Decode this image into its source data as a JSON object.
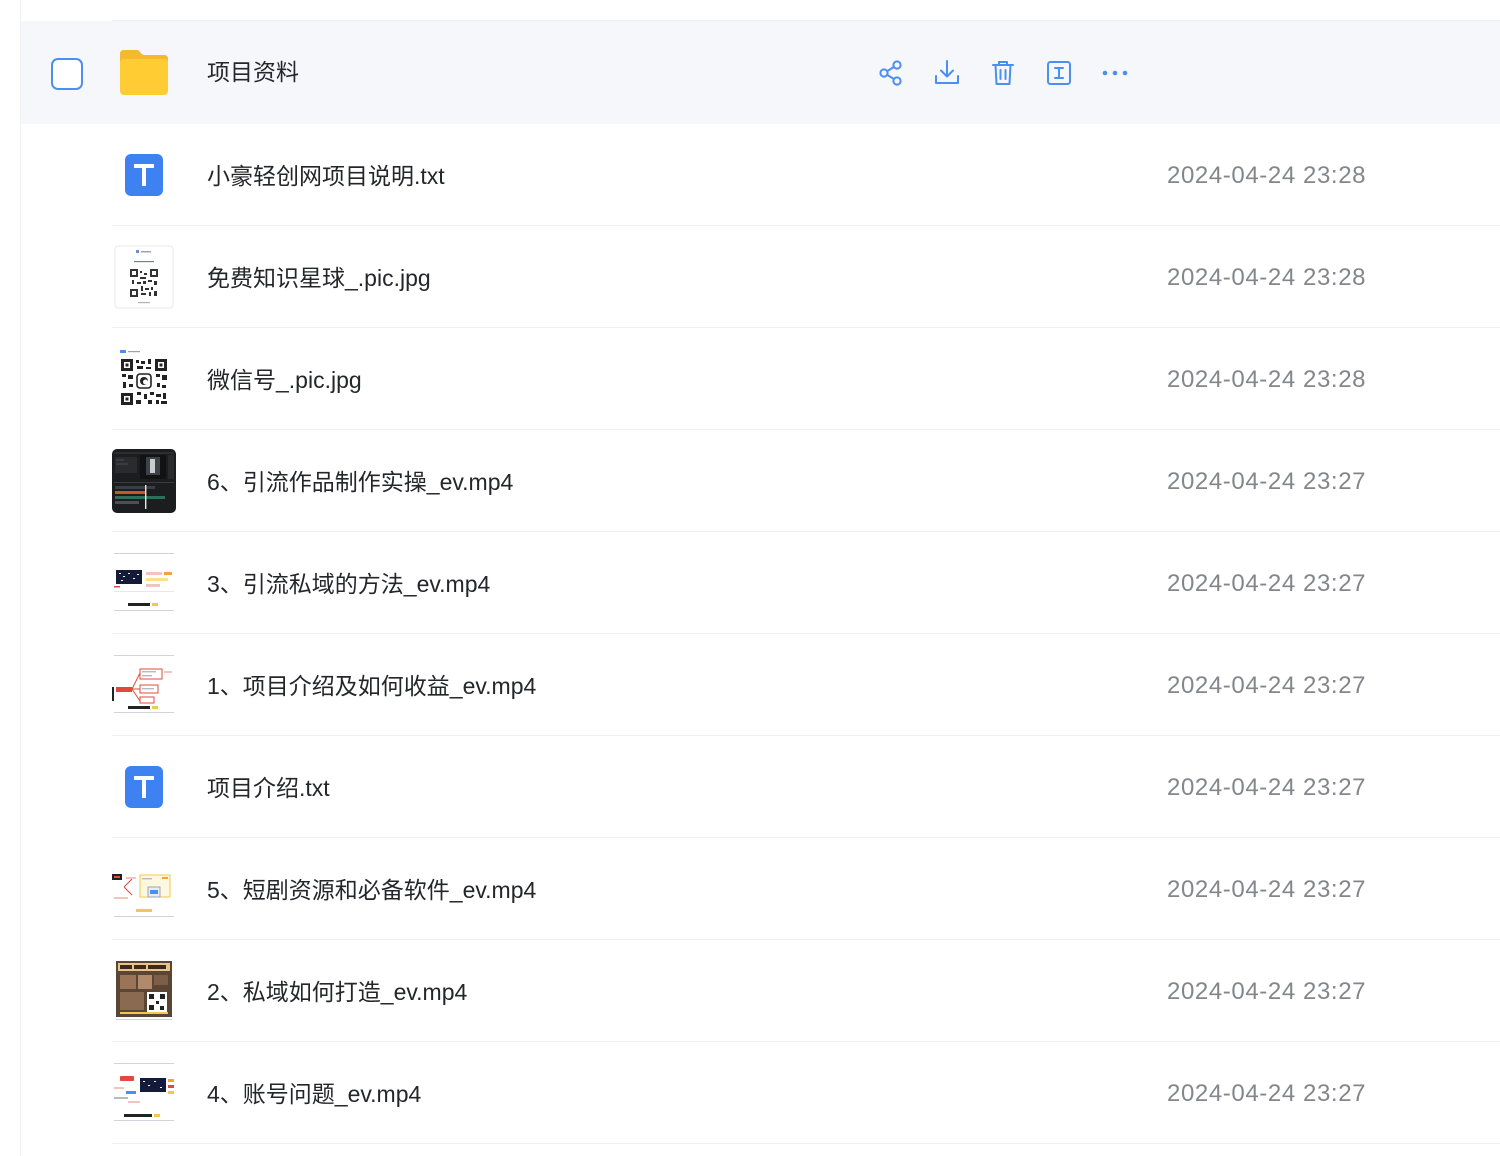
{
  "folder": {
    "name": "项目资料",
    "actions": [
      "share-icon",
      "download-icon",
      "delete-icon",
      "rename-icon",
      "more-icon"
    ]
  },
  "colors": {
    "accent": "#4a90f0",
    "folder_yellow": "#ffcc33",
    "txt_blue": "#3d82f0",
    "date_gray": "#84868c",
    "row_hover": "#f5f7fa"
  },
  "files": [
    {
      "name": "小豪轻创网项目说明.txt",
      "date": "2024-04-24 23:28",
      "thumb": "txt-icon"
    },
    {
      "name": "免费知识星球_.pic.jpg",
      "date": "2024-04-24 23:28",
      "thumb": "qr-card-thumb"
    },
    {
      "name": "微信号_.pic.jpg",
      "date": "2024-04-24 23:28",
      "thumb": "qr-thumb"
    },
    {
      "name": "6、引流作品制作实操_ev.mp4",
      "date": "2024-04-24 23:27",
      "thumb": "video-editor-thumb"
    },
    {
      "name": "3、引流私域的方法_ev.mp4",
      "date": "2024-04-24 23:27",
      "thumb": "mindmap-thumb"
    },
    {
      "name": "1、项目介绍及如何收益_ev.mp4",
      "date": "2024-04-24 23:27",
      "thumb": "mindmap-thumb"
    },
    {
      "name": "项目介绍.txt",
      "date": "2024-04-24 23:27",
      "thumb": "txt-icon"
    },
    {
      "name": "5、短剧资源和必备软件_ev.mp4",
      "date": "2024-04-24 23:27",
      "thumb": "mindmap-thumb"
    },
    {
      "name": "2、私域如何打造_ev.mp4",
      "date": "2024-04-24 23:27",
      "thumb": "poster-thumb"
    },
    {
      "name": "4、账号问题_ev.mp4",
      "date": "2024-04-24 23:27",
      "thumb": "mindmap-thumb"
    }
  ]
}
